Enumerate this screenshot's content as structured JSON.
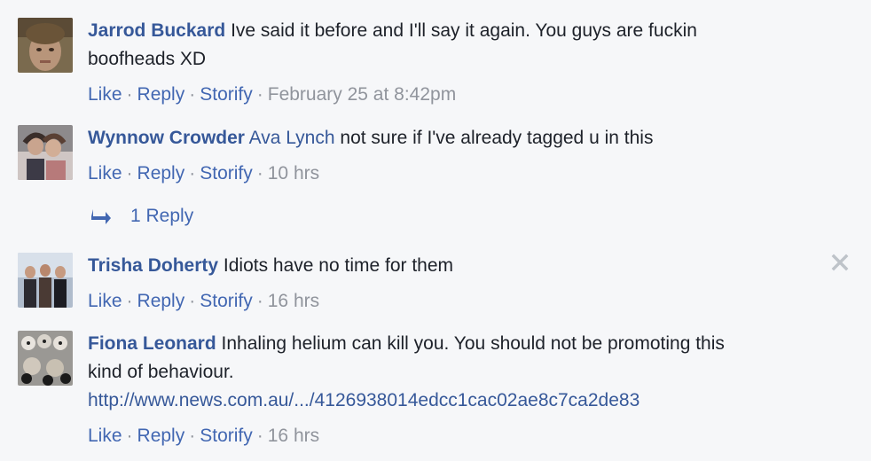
{
  "comments": [
    {
      "author": "Jarrod Buckard",
      "text_line1": "Ive said it before and I'll say it again. You guys are fuckin",
      "text_line2": "boofheads XD",
      "actions": {
        "like": "Like",
        "reply": "Reply",
        "storify": "Storify"
      },
      "timestamp": "February 25 at 8:42pm"
    },
    {
      "author": "Wynnow Crowder",
      "mention": "Ava Lynch",
      "text": "not sure if I've already tagged u in this",
      "actions": {
        "like": "Like",
        "reply": "Reply",
        "storify": "Storify"
      },
      "timestamp": "10 hrs",
      "replies_label": "1 Reply"
    },
    {
      "author": "Trisha Doherty",
      "text": "Idiots have no time for them",
      "actions": {
        "like": "Like",
        "reply": "Reply",
        "storify": "Storify"
      },
      "timestamp": "16 hrs"
    },
    {
      "author": "Fiona Leonard",
      "text_line1": "Inhaling helium can kill you. You should not be promoting this",
      "text_line2": "kind of behaviour.",
      "link": "http://www.news.com.au/.../4126938014edcc1cac02ae8c7ca2de83",
      "actions": {
        "like": "Like",
        "reply": "Reply",
        "storify": "Storify"
      },
      "timestamp": "16 hrs"
    }
  ],
  "separator": "·",
  "icons": [
    "reply-arrow-icon",
    "close-icon"
  ],
  "colors": {
    "background": "#f6f7f9",
    "author": "#365899",
    "action": "#4267b2",
    "meta": "#90949c",
    "text": "#1d2129"
  }
}
